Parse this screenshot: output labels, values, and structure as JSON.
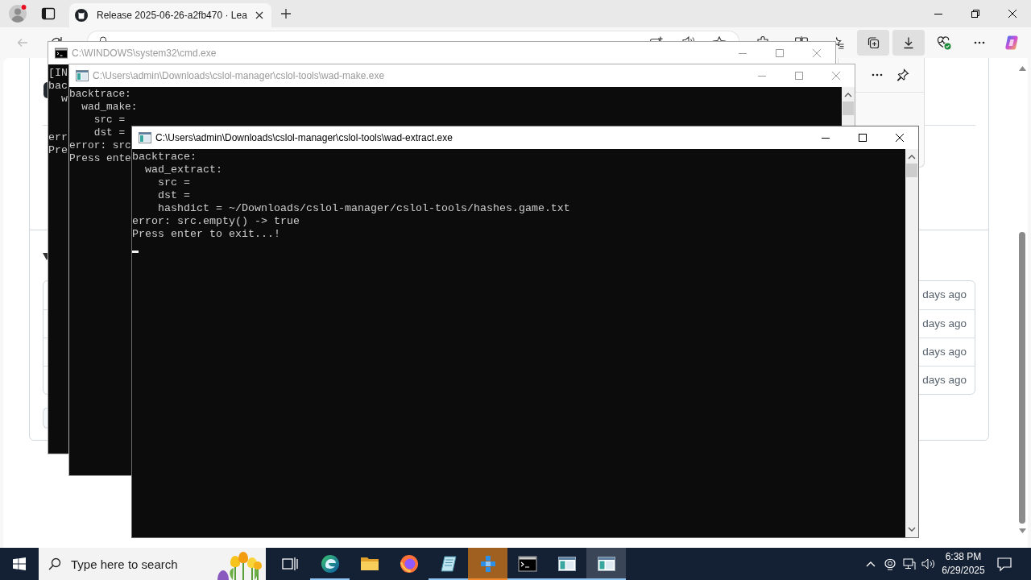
{
  "browser": {
    "tabs": [
      {
        "title": "Release 2025-06-26-a2fb470 · Lea",
        "selected": true
      }
    ],
    "toolbar_buttons": [
      {
        "kind": "extensions",
        "pressed": false
      },
      {
        "kind": "split",
        "pressed": false
      },
      {
        "kind": "favorites",
        "pressed": false
      },
      {
        "kind": "collections",
        "pressed": true
      },
      {
        "kind": "downloads",
        "pressed": true
      },
      {
        "kind": "essentials",
        "pressed": false
      },
      {
        "kind": "more",
        "pressed": false
      },
      {
        "kind": "assistant",
        "pressed": false
      }
    ],
    "asset_rows": [
      {
        "time": "days ago"
      },
      {
        "time": "days ago"
      },
      {
        "time": "days ago"
      },
      {
        "time": "days ago"
      }
    ]
  },
  "windows": [
    {
      "kind": "console",
      "title": "C:\\WINDOWS\\system32\\cmd.exe",
      "active": false,
      "lines": [
        {
          "text": "[IN"
        },
        {
          "text": "bac",
          "children": [
            {
              "text": "w"
            }
          ]
        },
        {
          "text": "err"
        },
        {
          "text": "Pre"
        }
      ]
    },
    {
      "kind": "app",
      "title": "C:\\Users\\admin\\Downloads\\cslol-manager\\cslol-tools\\wad-make.exe",
      "active": false,
      "lines": [
        {
          "text": "backtrace:",
          "children": [
            {
              "text": "wad_make:",
              "children": [
                {
                  "text": "src ="
                },
                {
                  "text": "dst ="
                }
              ]
            }
          ]
        },
        {
          "text": "error: src"
        },
        {
          "text": "Press ente"
        }
      ]
    },
    {
      "kind": "app",
      "title": "C:\\Users\\admin\\Downloads\\cslol-manager\\cslol-tools\\wad-extract.exe",
      "active": true,
      "cursor": true,
      "lines": [
        {
          "text": "backtrace:",
          "children": [
            {
              "text": "wad_extract:",
              "children": [
                {
                  "text": "src ="
                },
                {
                  "text": "dst ="
                },
                {
                  "text": "hashdict = ~/Downloads/cslol-manager/cslol-tools/hashes.game.txt"
                }
              ]
            }
          ]
        },
        {
          "text": "error: src.empty() -> true"
        },
        {
          "text": "Press enter to exit...!"
        }
      ]
    }
  ],
  "taskbar": {
    "search": {
      "placeholder": "Type here to search"
    },
    "apps": [
      {
        "kind": "wave",
        "running": true,
        "selected": false,
        "attention": false
      },
      {
        "kind": "folder",
        "running": false,
        "selected": false,
        "attention": false
      },
      {
        "kind": "fox",
        "running": false,
        "selected": false,
        "attention": false
      },
      {
        "kind": "notebook",
        "running": true,
        "selected": false,
        "attention": false
      },
      {
        "kind": "cubes",
        "running": true,
        "selected": false,
        "attention": true
      },
      {
        "kind": "console",
        "running": true,
        "selected": false,
        "attention": false
      },
      {
        "kind": "window",
        "running": true,
        "selected": false,
        "attention": false
      },
      {
        "kind": "window",
        "running": true,
        "selected": true,
        "attention": false
      }
    ],
    "clock": {
      "time": "6:38 PM",
      "date": "6/29/2025"
    }
  }
}
